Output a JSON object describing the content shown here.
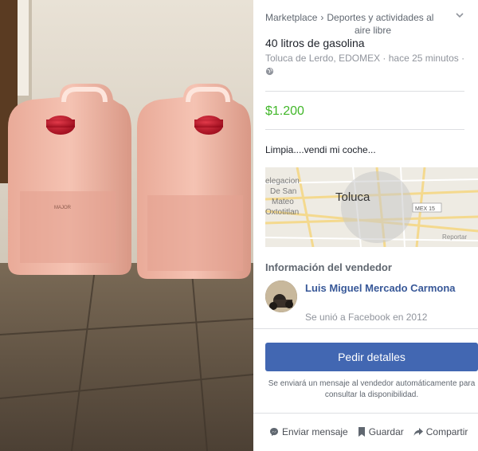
{
  "breadcrumb": {
    "root": "Marketplace",
    "separator": "›",
    "category": "Deportes y actividades al",
    "category_cont": "aire libre"
  },
  "listing": {
    "title": "40 litros de gasolina",
    "location": "Toluca de Lerdo, EDOMEX · hace 25 minutos ·",
    "price": "$1.200",
    "description": "Limpia....vendi mi coche..."
  },
  "map": {
    "labels": [
      "elegacion",
      "De San",
      "Mateo",
      "Oxtotitlan",
      "Toluca",
      "MEX 15",
      "Reportar"
    ]
  },
  "seller": {
    "heading": "Información del vendedor",
    "name": "Luis Miguel Mercado Carmona",
    "joined": "Se unió a Facebook en 2012"
  },
  "cta": {
    "label": "Pedir detalles",
    "note": "Se enviará un mensaje al vendedor automáticamente para consultar la disponibilidad."
  },
  "actions": {
    "message": "Enviar mensaje",
    "save": "Guardar",
    "share": "Compartir"
  },
  "colors": {
    "price": "#42b72a",
    "link": "#385898",
    "button": "#4267b2"
  }
}
